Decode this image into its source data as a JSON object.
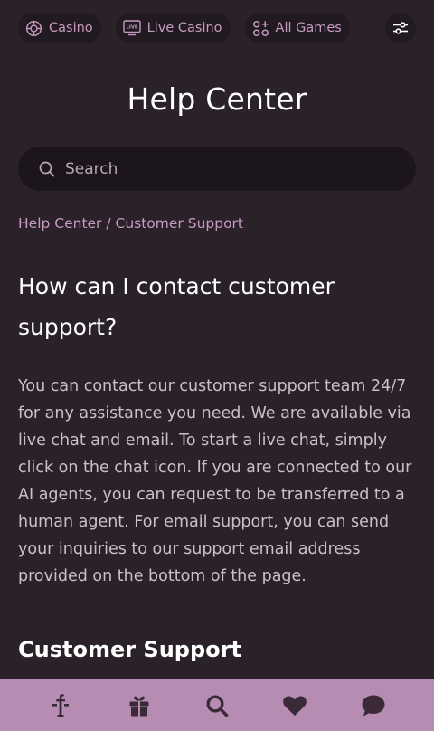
{
  "topnav": {
    "items": [
      {
        "label": "Casino",
        "icon": "casino-chip-icon"
      },
      {
        "label": "Live Casino",
        "icon": "live-tv-icon"
      },
      {
        "label": "All Games",
        "icon": "all-games-icon"
      }
    ],
    "filter_icon": "sliders-icon"
  },
  "page": {
    "title": "Help Center"
  },
  "search": {
    "placeholder": "Search"
  },
  "breadcrumb": "Help Center / Customer Support",
  "article": {
    "question": "How can I contact customer support?",
    "answer": "You can contact our customer support team 24/7 for any assistance you need. We are available via live chat and email. To start a live chat, simply click on the chat icon. If you are connected to our AI agents, you can request to be transferred to a human agent. For email support, you can send your inquiries to our support email address provided on the bottom of the page.",
    "section_title": "Customer Support"
  },
  "bottombar": {
    "items": [
      "logo-icon",
      "gift-icon",
      "search-icon",
      "heart-icon",
      "chat-icon"
    ]
  },
  "colors": {
    "background": "#2a2129",
    "accent": "#c79ac2",
    "bottombar": "#b78cb3",
    "icon_dark": "#3a2a38"
  }
}
